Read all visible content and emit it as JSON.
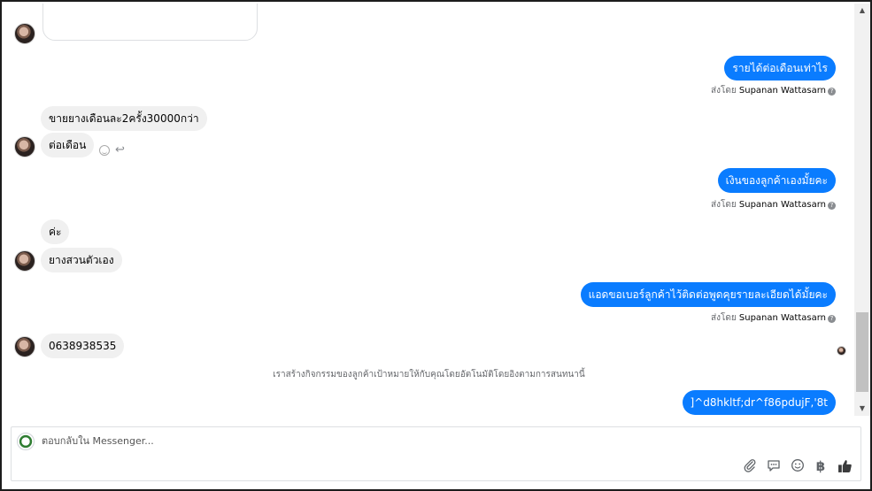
{
  "thread": {
    "system_note": "เราสร้างกิจกรรมของลูกค้าเป้าหมายให้กับคุณโดยอัตโนมัติโดยอิงตามการสนทนานี้",
    "incoming": [
      {
        "text": "ขายยางเดือนละ2ครั้ง30000กว่า"
      },
      {
        "text": "ต่อเดือน"
      },
      {
        "text": "ค่ะ"
      },
      {
        "text": "ยางสวนตัวเอง"
      },
      {
        "text": "0638938535"
      }
    ],
    "outgoing": [
      {
        "text": "รายได้ต่อเดือนเท่าไร"
      },
      {
        "text": "เงินของลูกค้าเองมั้ยคะ"
      },
      {
        "text": "แอดขอเบอร์ลูกค้าไว้ติดต่อพูดคุยรายละเอียดได้มั้ยคะ"
      },
      {
        "text": "]^d8hkltf;dr^f86pdujF,'8t"
      }
    ],
    "sent_by_prefix": "ส่งโดย",
    "sent_by_name": "Supanan Wattasarn"
  },
  "composer": {
    "placeholder": "ตอบกลับใน Messenger..."
  },
  "icons": {
    "attach": "paperclip-icon",
    "saved_reply": "chat-bubble-icon",
    "emoji": "smiley-icon",
    "currency": "baht-icon",
    "like": "thumbs-up-icon"
  },
  "colors": {
    "outgoing_bubble": "#0a7cff",
    "incoming_bubble": "#f0f0f0"
  }
}
